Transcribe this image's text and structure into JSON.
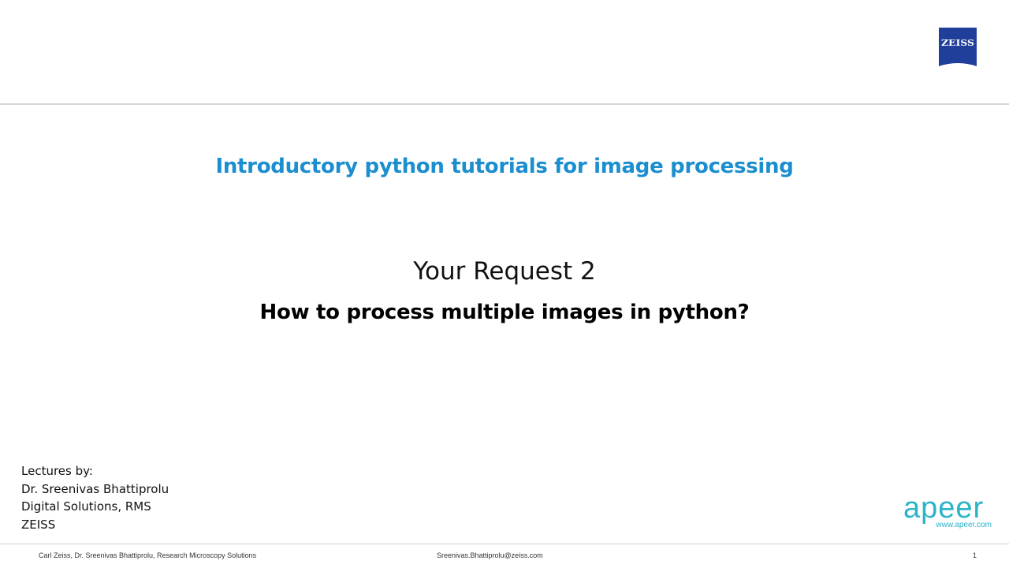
{
  "logo": {
    "brand_text": "ZEISS",
    "brand_color": "#1f3f9a"
  },
  "title": "Introductory python tutorials for image processing",
  "request": "Your Request 2",
  "question": "How to process multiple images in python?",
  "lecturer": {
    "lines": [
      "Lectures by:",
      "Dr. Sreenivas Bhattiprolu",
      "Digital Solutions, RMS",
      "ZEISS"
    ]
  },
  "apeer": {
    "wordmark": "apeer",
    "url": "www.apeer.com",
    "color": "#2bb3c8"
  },
  "footer": {
    "left": "Carl Zeiss, Dr. Sreenivas Bhattiprolu, Research Microscopy Solutions",
    "center": "Sreenivas.Bhattiprolu@zeiss.com",
    "page": "1"
  },
  "colors": {
    "title": "#1b8ed0",
    "rule": "#d6d6d6"
  }
}
